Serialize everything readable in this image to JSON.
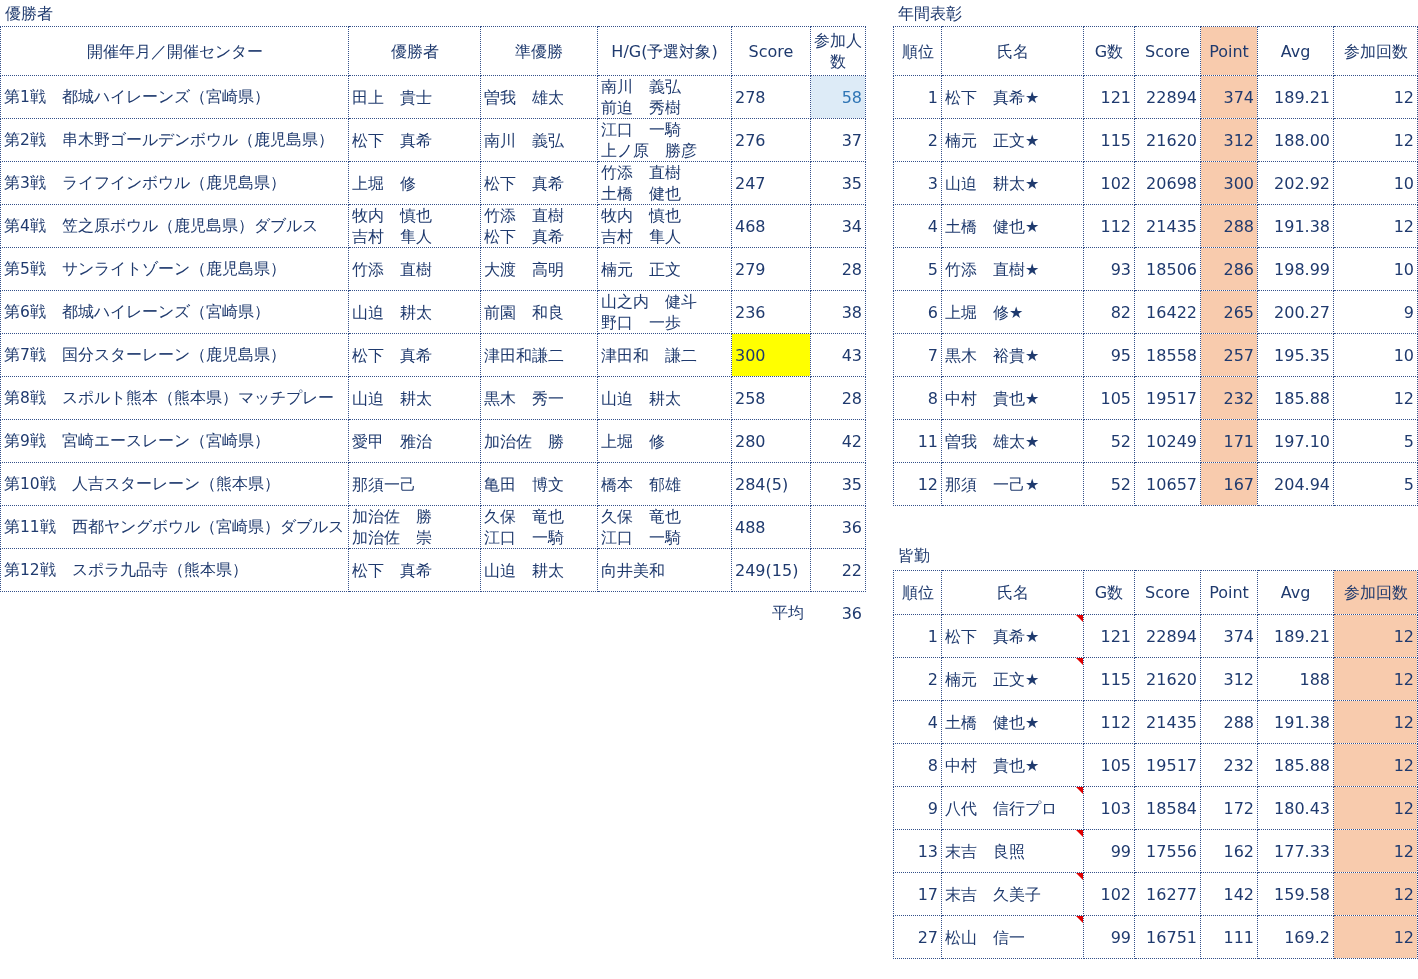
{
  "winners": {
    "title": "優勝者",
    "columns": [
      "開催年月／開催センター",
      "優勝者",
      "準優勝",
      "H/G(予選対象)",
      "Score",
      "参加人数"
    ],
    "rows": [
      {
        "event": "第1戦　都城ハイレーンズ（宮崎県）",
        "winner": [
          "田上　貴士"
        ],
        "runner_up": [
          "曽我　雄太"
        ],
        "hg": [
          "南川　義弘",
          "前迫　秀樹"
        ],
        "score": "278",
        "participants": "58",
        "score_highlighted": false,
        "participants_highlighted": true
      },
      {
        "event": "第2戦　串木野ゴールデンボウル（鹿児島県）",
        "winner": [
          "松下　真希"
        ],
        "runner_up": [
          "南川　義弘"
        ],
        "hg": [
          "江口　一騎",
          "上ノ原　勝彦"
        ],
        "score": "276",
        "participants": "37",
        "score_highlighted": false,
        "participants_highlighted": false
      },
      {
        "event": "第3戦　ライフインボウル（鹿児島県）",
        "winner": [
          "上堀　修"
        ],
        "runner_up": [
          "松下　真希"
        ],
        "hg": [
          "竹添　直樹",
          "土橋　健也"
        ],
        "score": "247",
        "participants": "35",
        "score_highlighted": false,
        "participants_highlighted": false
      },
      {
        "event": "第4戦　笠之原ボウル（鹿児島県）ダブルス",
        "winner": [
          "牧内　慎也",
          "吉村　隼人"
        ],
        "runner_up": [
          "竹添　直樹",
          "松下　真希"
        ],
        "hg": [
          "牧内　慎也",
          "吉村　隼人"
        ],
        "score": "468",
        "participants": "34",
        "score_highlighted": false,
        "participants_highlighted": false
      },
      {
        "event": "第5戦　サンライトゾーン（鹿児島県）",
        "winner": [
          "竹添　直樹"
        ],
        "runner_up": [
          "大渡　高明"
        ],
        "hg": [
          "楠元　正文"
        ],
        "score": "279",
        "participants": "28",
        "score_highlighted": false,
        "participants_highlighted": false
      },
      {
        "event": "第6戦　都城ハイレーンズ（宮崎県）",
        "winner": [
          "山迫　耕太"
        ],
        "runner_up": [
          "前園　和良"
        ],
        "hg": [
          "山之内　健斗",
          "野口　一歩"
        ],
        "score": "236",
        "participants": "38",
        "score_highlighted": false,
        "participants_highlighted": false
      },
      {
        "event": "第7戦　国分スターレーン（鹿児島県）",
        "winner": [
          "松下　真希"
        ],
        "runner_up": [
          "津田和謙二"
        ],
        "hg": [
          "津田和　謙二"
        ],
        "score": "300",
        "participants": "43",
        "score_highlighted": true,
        "participants_highlighted": false
      },
      {
        "event": "第8戦　スポルト熊本（熊本県）マッチプレー",
        "winner": [
          "山迫　耕太"
        ],
        "runner_up": [
          "黒木　秀一"
        ],
        "hg": [
          "山迫　耕太"
        ],
        "score": "258",
        "participants": "28",
        "score_highlighted": false,
        "participants_highlighted": false
      },
      {
        "event": "第9戦　宮崎エースレーン（宮崎県）",
        "winner": [
          "愛甲　雅治"
        ],
        "runner_up": [
          "加治佐　勝"
        ],
        "hg": [
          "上堀　修"
        ],
        "score": "280",
        "participants": "42",
        "score_highlighted": false,
        "participants_highlighted": false
      },
      {
        "event": "第10戦　人吉スターレーン（熊本県）",
        "winner": [
          "那須一己"
        ],
        "runner_up": [
          "亀田　博文"
        ],
        "hg": [
          "橋本　郁雄"
        ],
        "score": "284(5)",
        "participants": "35",
        "score_highlighted": false,
        "participants_highlighted": false
      },
      {
        "event": "第11戦　西都ヤングボウル（宮崎県）ダブルス",
        "winner": [
          "加治佐　勝",
          "加治佐　崇"
        ],
        "runner_up": [
          "久保　竜也",
          "江口　一騎"
        ],
        "hg": [
          "久保　竜也",
          "江口　一騎"
        ],
        "score": "488",
        "participants": "36",
        "score_highlighted": false,
        "participants_highlighted": false
      },
      {
        "event": "第12戦　スポラ九品寺（熊本県）",
        "winner": [
          "松下　真希"
        ],
        "runner_up": [
          "山迫　耕太"
        ],
        "hg": [
          "向井美和"
        ],
        "score": "249(15)",
        "participants": "22",
        "score_highlighted": false,
        "participants_highlighted": false
      }
    ],
    "average_label": "平均",
    "average_value": "36"
  },
  "annual_awards": {
    "title": "年間表彰",
    "columns": [
      {
        "label": "順位",
        "highlighted": false
      },
      {
        "label": "氏名",
        "highlighted": false
      },
      {
        "label": "G数",
        "highlighted": false
      },
      {
        "label": "Score",
        "highlighted": false
      },
      {
        "label": "Point",
        "highlighted": true
      },
      {
        "label": "Avg",
        "highlighted": false
      },
      {
        "label": "参加回数",
        "highlighted": false
      }
    ],
    "rows": [
      {
        "cells": [
          "1",
          "松下　真希★",
          "121",
          "22894",
          "374",
          "189.21",
          "12"
        ],
        "commented": false
      },
      {
        "cells": [
          "2",
          "楠元　正文★",
          "115",
          "21620",
          "312",
          "188.00",
          "12"
        ],
        "commented": false
      },
      {
        "cells": [
          "3",
          "山迫　耕太★",
          "102",
          "20698",
          "300",
          "202.92",
          "10"
        ],
        "commented": false
      },
      {
        "cells": [
          "4",
          "土橋　健也★",
          "112",
          "21435",
          "288",
          "191.38",
          "12"
        ],
        "commented": false
      },
      {
        "cells": [
          "5",
          "竹添　直樹★",
          "93",
          "18506",
          "286",
          "198.99",
          "10"
        ],
        "commented": false
      },
      {
        "cells": [
          "6",
          "上堀　修★",
          "82",
          "16422",
          "265",
          "200.27",
          "9"
        ],
        "commented": false
      },
      {
        "cells": [
          "7",
          "黒木　裕貴★",
          "95",
          "18558",
          "257",
          "195.35",
          "10"
        ],
        "commented": false
      },
      {
        "cells": [
          "8",
          "中村　貴也★",
          "105",
          "19517",
          "232",
          "185.88",
          "12"
        ],
        "commented": false
      },
      {
        "cells": [
          "11",
          "曽我　雄太★",
          "52",
          "10249",
          "171",
          "197.10",
          "5"
        ],
        "commented": false
      },
      {
        "cells": [
          "12",
          "那須　一己★",
          "52",
          "10657",
          "167",
          "204.94",
          "5"
        ],
        "commented": false
      }
    ]
  },
  "perfect_attendance": {
    "title": "皆勤",
    "columns": [
      {
        "label": "順位",
        "highlighted": false
      },
      {
        "label": "氏名",
        "highlighted": false
      },
      {
        "label": "G数",
        "highlighted": false
      },
      {
        "label": "Score",
        "highlighted": false
      },
      {
        "label": "Point",
        "highlighted": false
      },
      {
        "label": "Avg",
        "highlighted": false
      },
      {
        "label": "参加回数",
        "highlighted": true
      }
    ],
    "rows": [
      {
        "cells": [
          "1",
          "松下　真希★",
          "121",
          "22894",
          "374",
          "189.21",
          "12"
        ],
        "commented": true
      },
      {
        "cells": [
          "2",
          "楠元　正文★",
          "115",
          "21620",
          "312",
          "188",
          "12"
        ],
        "commented": true
      },
      {
        "cells": [
          "4",
          "土橋　健也★",
          "112",
          "21435",
          "288",
          "191.38",
          "12"
        ],
        "commented": false
      },
      {
        "cells": [
          "8",
          "中村　貴也★",
          "105",
          "19517",
          "232",
          "185.88",
          "12"
        ],
        "commented": false
      },
      {
        "cells": [
          "9",
          "八代　信行プロ",
          "103",
          "18584",
          "172",
          "180.43",
          "12"
        ],
        "commented": true
      },
      {
        "cells": [
          "13",
          "末吉　良照",
          "99",
          "17556",
          "162",
          "177.33",
          "12"
        ],
        "commented": true
      },
      {
        "cells": [
          "17",
          "末吉　久美子",
          "102",
          "16277",
          "142",
          "159.58",
          "12"
        ],
        "commented": true
      },
      {
        "cells": [
          "27",
          "松山　信一",
          "99",
          "16751",
          "111",
          "169.2",
          "12"
        ],
        "commented": true
      }
    ]
  }
}
